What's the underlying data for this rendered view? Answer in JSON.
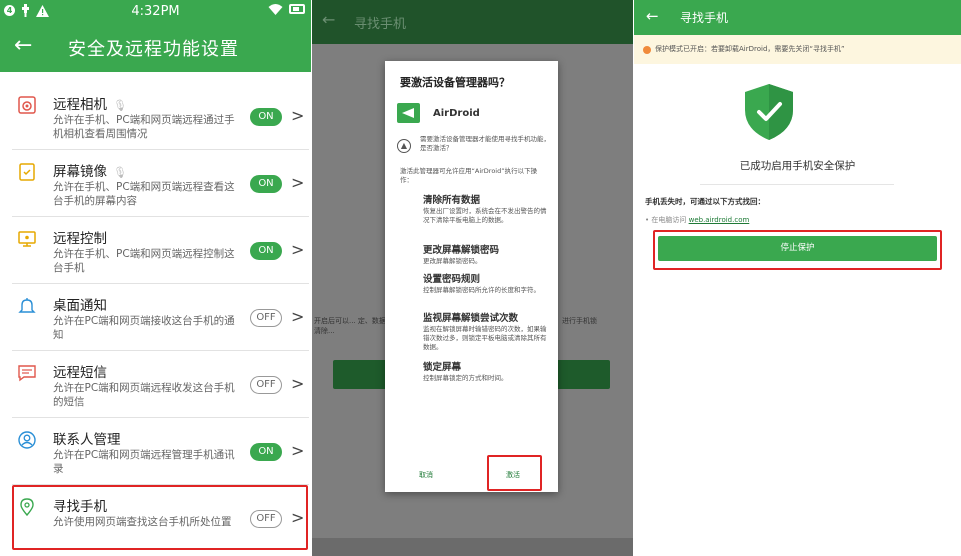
{
  "colors": {
    "brand_green": "#3aa84f",
    "dark_green": "#20532a",
    "highlight_red": "#e02424",
    "warning_orange": "#f08a3a"
  },
  "panel1": {
    "status_bar": {
      "time": "4:32PM",
      "left_icons": [
        "notification-icon",
        "usb-icon",
        "warning-icon"
      ],
      "right_icons": [
        "wifi-icon",
        "battery-icon"
      ]
    },
    "header": {
      "title": "安全及远程功能设置",
      "back_icon": "arrow-left-icon"
    },
    "items": [
      {
        "title": "远程相机",
        "desc": "允许在手机、PC端和网页端远程通过手机相机查看周围情况",
        "toggle": "ON",
        "icon": "camera-icon",
        "mic": true
      },
      {
        "title": "屏幕镜像",
        "desc": "允许在手机、PC端和网页端远程查看这台手机的屏幕内容",
        "toggle": "ON",
        "icon": "screen-mirror-icon",
        "mic": true
      },
      {
        "title": "远程控制",
        "desc": "允许在手机、PC端和网页端远程控制这台手机",
        "toggle": "ON",
        "icon": "remote-control-icon",
        "mic": false
      },
      {
        "title": "桌面通知",
        "desc": "允许在PC端和网页端接收这台手机的通知",
        "toggle": "OFF",
        "icon": "bell-icon",
        "mic": false
      },
      {
        "title": "远程短信",
        "desc": "允许在PC端和网页端远程收发这台手机的短信",
        "toggle": "OFF",
        "icon": "message-icon",
        "mic": false
      },
      {
        "title": "联系人管理",
        "desc": "允许在PC端和网页端远程管理手机通讯录",
        "toggle": "ON",
        "icon": "contact-icon",
        "mic": false
      },
      {
        "title": "寻找手机",
        "desc": "允许使用网页端查找这台手机所处位置",
        "toggle": "OFF",
        "icon": "location-pin-icon",
        "mic": false
      }
    ]
  },
  "panel2": {
    "header": {
      "title": "寻找手机",
      "back_icon": "arrow-left-icon"
    },
    "background_text_left": "开启后可以... 定、数据清除...",
    "background_text_right": "进行手机锁",
    "dialog": {
      "title": "要激活设备管理器吗？",
      "app_name": "AirDroid",
      "note": "需要激活设备管理器才能使用寻找手机功能，是否激活？",
      "intro": "激活此管理器可允许应用“AirDroid”执行以下操作：",
      "permissions": [
        {
          "title": "清除所有数据",
          "desc": "恢复出厂设置时，系统会在不发出警告的情况下清除平板电脑上的数据。"
        },
        {
          "title": "更改屏幕解锁密码",
          "desc": "更改屏幕解锁密码。"
        },
        {
          "title": "设置密码规则",
          "desc": "控制屏幕解锁密码所允许的长度和字符。"
        },
        {
          "title": "监视屏幕解锁尝试次数",
          "desc": "监视在解锁屏幕时输错密码的次数，如果输错次数过多，则锁定平板电脑或清除其所有数据。"
        },
        {
          "title": "锁定屏幕",
          "desc": "控制屏幕锁定的方式和时间。"
        }
      ],
      "cancel_label": "取消",
      "activate_label": "激活"
    }
  },
  "panel3": {
    "header": {
      "title": "寻找手机",
      "back_icon": "arrow-left-icon"
    },
    "warning": "保护模式已开启：若要卸载AirDroid，需要先关闭“寻找手机”",
    "shield_icon": "shield-check-icon",
    "success_text": "已成功启用手机安全保护",
    "lost_label": "手机丢失时，可通过以下方式找回：",
    "visit_prefix": "在电脑访问",
    "visit_link": "web.airdroid.com",
    "stop_button": "停止保护"
  }
}
